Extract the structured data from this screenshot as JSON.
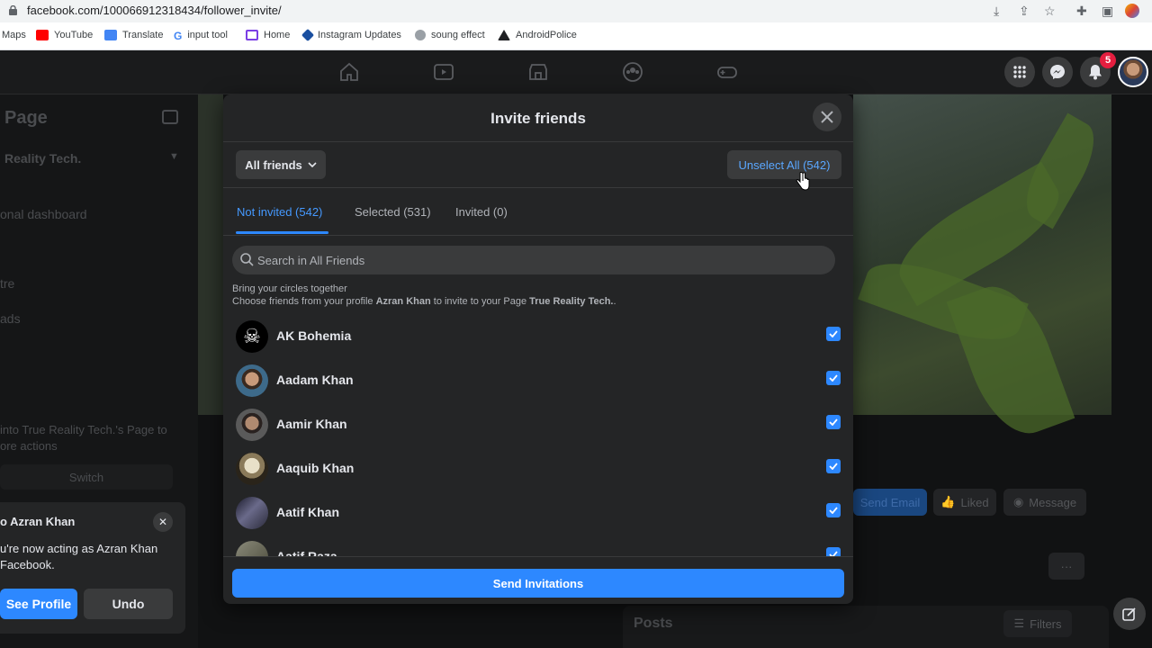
{
  "browser": {
    "url": "facebook.com/100066912318434/follower_invite/",
    "bookmarks": [
      "Maps",
      "YouTube",
      "Translate",
      "input tool",
      "Home",
      "Instagram Updates",
      "soung effect",
      "AndroidPolice"
    ]
  },
  "fb_nav": {
    "notification_count": "5"
  },
  "background_page": {
    "page_heading": "Page",
    "page_name": "Reality Tech.",
    "menu_items": [
      "onal dashboard",
      "tre",
      "ads"
    ],
    "switch_prompt": "into True Reality Tech.'s Page to ore actions",
    "switch_label": "Switch",
    "buttons": {
      "send_email": "Send Email",
      "liked": "Liked",
      "message": "Message",
      "more": "···"
    },
    "posts_label": "Posts",
    "filters_label": "Filters"
  },
  "toast": {
    "title": "o Azran Khan",
    "message": "u're now acting as Azran Khan Facebook.",
    "see_profile": "See Profile",
    "undo": "Undo"
  },
  "modal": {
    "title": "Invite friends",
    "filter_label": "All friends",
    "unselect_label": "Unselect All (542)",
    "tabs": [
      {
        "label": "Not invited (542)",
        "active": true
      },
      {
        "label": "Selected (531)",
        "active": false
      },
      {
        "label": "Invited (0)",
        "active": false
      }
    ],
    "search_placeholder": "Search in All Friends",
    "circles_heading": "Bring your circles together",
    "circles_text_pre": "Choose friends from your profile ",
    "circles_profile": "Azran Khan",
    "circles_text_mid": " to invite to your Page ",
    "circles_page": "True Reality Tech.",
    "circles_text_post": ".",
    "friends": [
      {
        "name": "AK Bohemia",
        "checked": true
      },
      {
        "name": "Aadam Khan",
        "checked": true
      },
      {
        "name": "Aamir Khan",
        "checked": true
      },
      {
        "name": "Aaquib Khan",
        "checked": true
      },
      {
        "name": "Aatif Khan",
        "checked": true
      },
      {
        "name": "Aatif Raza",
        "checked": true
      }
    ],
    "send_label": "Send Invitations"
  },
  "colors": {
    "accent": "#2d88ff",
    "modal_bg": "#242526",
    "page_bg": "#18191a"
  }
}
